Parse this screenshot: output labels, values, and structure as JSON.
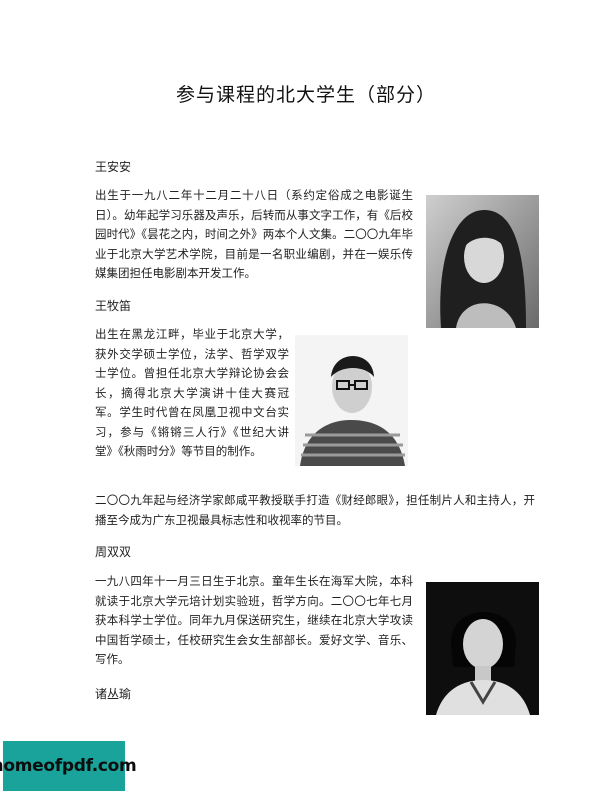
{
  "page": {
    "title": "参与课程的北大学生（部分）"
  },
  "people": [
    {
      "name": "王安安",
      "bio": "出生于一九八二年十二月二十八日（系约定俗成之电影诞生日）。幼年起学习乐器及声乐，后转而从事文字工作，有《后校园时代》《昙花之内，时间之外》两本个人文集。二〇〇九年毕业于北京大学艺术学院，目前是一名职业编剧，并在一娱乐传媒集团担任电影剧本开发工作。"
    },
    {
      "name": "王牧笛",
      "bio": "出生在黑龙江畔，毕业于北京大学，获外交学硕士学位，法学、哲学双学士学位。曾担任北京大学辩论协会会长，摘得北京大学演讲十佳大赛冠军。学生时代曾在凤凰卫视中文台实习，参与《锵锵三人行》《世纪大讲堂》《秋雨时分》等节目的制作。",
      "bio_continued": "二〇〇九年起与经济学家郎咸平教授联手打造《财经郎眼》，担任制片人和主持人，开播至今成为广东卫视最具标志性和收视率的节目。"
    },
    {
      "name": "周双双",
      "bio": "一九八四年十一月三日生于北京。童年生长在海军大院，本科就读于北京大学元培计划实验班，哲学方向。二〇〇七年七月获本科学士学位。同年九月保送研究生，继续在北京大学攻读中国哲学硕士，任校研究生会女生部部长。爱好文学、音乐、写作。"
    },
    {
      "name": "诸丛瑜"
    }
  ],
  "watermark": {
    "text": "homeofpdf.com",
    "color": "#1aa39a"
  }
}
